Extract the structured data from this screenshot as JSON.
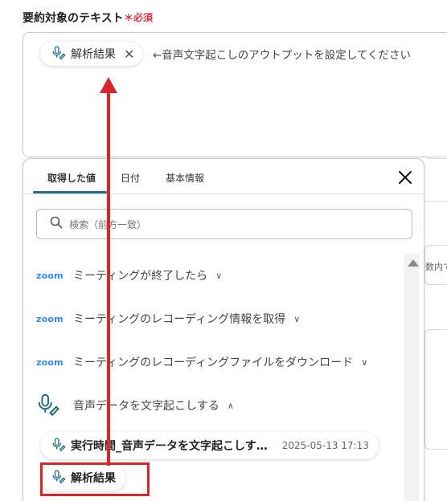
{
  "field": {
    "label": "要約対象のテキスト",
    "required": "＊必須",
    "chip_label": "解析結果",
    "chip_close": "✕",
    "hint": "←音声文字起こしのアウトプットを設定してください"
  },
  "background": {
    "snippet": "数内で"
  },
  "panel": {
    "tabs": [
      {
        "label": "取得した値"
      },
      {
        "label": "日付"
      },
      {
        "label": "基本情報"
      }
    ],
    "close_label": "✕",
    "search_placeholder": "検索（前方一致）",
    "items": [
      {
        "logo": "zoom",
        "label": "ミーティングが終了したら",
        "chevron": "∨"
      },
      {
        "logo": "zoom",
        "label": "ミーティングのレコーディング情報を取得",
        "chevron": "∨"
      },
      {
        "logo": "zoom",
        "label": "ミーティングのレコーディングファイルをダウンロード",
        "chevron": "∨"
      },
      {
        "logo": "mic-icon",
        "label": "音声データを文字起こしする",
        "chevron": "∧"
      }
    ],
    "sub_items": [
      {
        "label": "実行時間_音声データを文字起こしす…",
        "timestamp": "2025-05-13 17:13"
      },
      {
        "label": "解析結果",
        "timestamp": ""
      }
    ]
  },
  "colors": {
    "accent": "#1f6f7d",
    "required": "#e0344a",
    "annotation": "#d9262b",
    "zoom": "#2d8cff"
  }
}
